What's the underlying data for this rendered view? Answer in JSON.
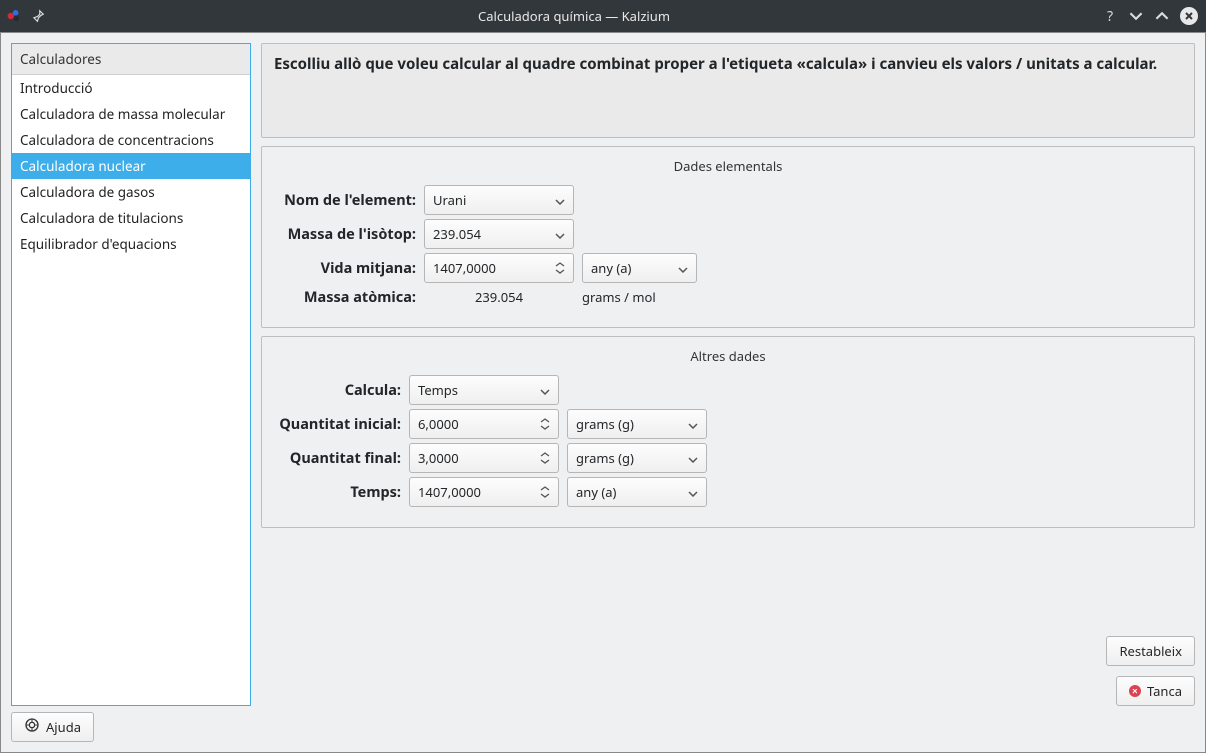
{
  "title": "Calculadora química — Kalzium",
  "sidebar": {
    "header": "Calculadores",
    "items": [
      "Introducció",
      "Calculadora de massa molecular",
      "Calculadora de concentracions",
      "Calculadora nuclear",
      "Calculadora de gasos",
      "Calculadora de titulacions",
      "Equilibrador d'equacions"
    ],
    "selected_index": 3
  },
  "instructions": "Escolliu allò que voleu calcular al quadre combinat proper a l'etiqueta «calcula» i canvieu els valors / unitats a calcular.",
  "group1": {
    "title": "Dades elementals",
    "element_label": "Nom de l'element:",
    "element_value": "Urani",
    "isotope_label": "Massa de l'isòtop:",
    "isotope_value": "239.054",
    "halflife_label": "Vida mitjana:",
    "halflife_value": "1407,0000",
    "halflife_unit": "any (a)",
    "atomic_mass_label": "Massa atòmica:",
    "atomic_mass_value": "239.054",
    "atomic_mass_unit": "grams / mol"
  },
  "group2": {
    "title": "Altres dades",
    "calc_label": "Calcula:",
    "calc_value": "Temps",
    "init_label": "Quantitat inicial:",
    "init_value": "6,0000",
    "init_unit": "grams (g)",
    "final_label": "Quantitat final:",
    "final_value": "3,0000",
    "final_unit": "grams (g)",
    "time_label": "Temps:",
    "time_value": "1407,0000",
    "time_unit": "any (a)"
  },
  "buttons": {
    "help": "Ajuda",
    "reset": "Restableix",
    "close": "Tanca"
  }
}
